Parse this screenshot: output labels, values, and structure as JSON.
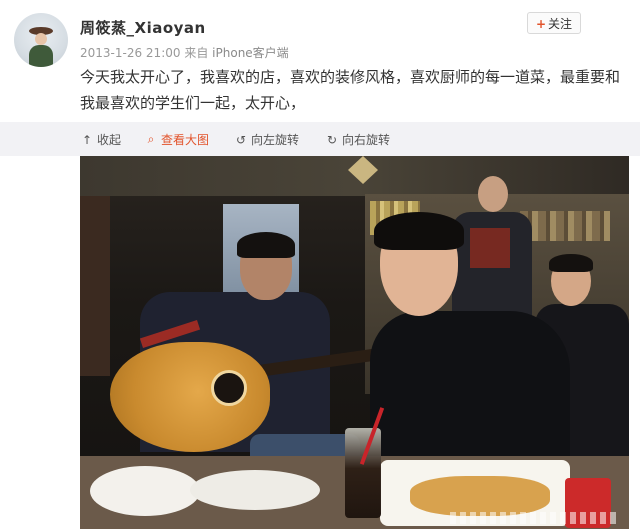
{
  "post": {
    "username": "周筱蒸_Xiaoyan",
    "timestamp": "2013-1-26 21:00",
    "source_prefix": "来自",
    "source": "iPhone客户端",
    "follow_label": "关注",
    "text": "今天我太开心了，我喜欢的店，喜欢的装修风格，喜欢厨师的每一道菜，最重要和我最喜欢的学生们一起，太开心，"
  },
  "toolbar": {
    "collapse": "收起",
    "view_large": "查看大图",
    "rotate_left": "向左旋转",
    "rotate_right": "向右旋转"
  },
  "icons": {
    "collapse": "arrow-up-icon",
    "view_large": "magnifier-icon",
    "rotate_left": "rotate-left-icon",
    "rotate_right": "rotate-right-icon",
    "follow": "plus-icon"
  },
  "colors": {
    "accent": "#e2542c",
    "toolbar_bg": "#f2f2f5",
    "text": "#333333",
    "meta": "#999999"
  }
}
